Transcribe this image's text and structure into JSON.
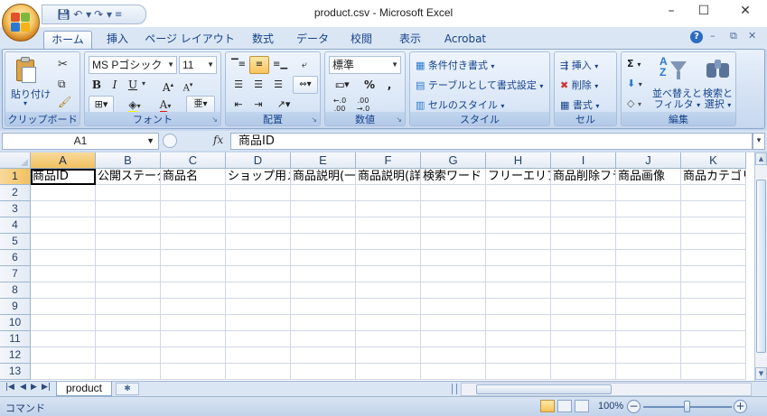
{
  "window": {
    "title": "product.csv - Microsoft Excel",
    "minimize_glyph": "–",
    "maximize_glyph": "☐",
    "close_glyph": "✕"
  },
  "qat": {
    "save_icon": "save-icon",
    "undo_icon": "undo-icon",
    "redo_icon": "redo-icon"
  },
  "ribbon_tabs": [
    "ホーム",
    "挿入",
    "ページ レイアウト",
    "数式",
    "データ",
    "校閲",
    "表示",
    "Acrobat"
  ],
  "active_tab": "ホーム",
  "groups": {
    "clipboard": {
      "label": "クリップボード",
      "paste": "貼り付け"
    },
    "font": {
      "label": "フォント",
      "font_name": "MS Pゴシック",
      "font_size": "11",
      "bold": "B",
      "italic": "I",
      "underline": "U"
    },
    "alignment": {
      "label": "配置"
    },
    "number": {
      "label": "数値",
      "format": "標準",
      "percent": "%",
      "comma": ","
    },
    "styles": {
      "label": "スタイル",
      "conditional": "条件付き書式",
      "table": "テーブルとして書式設定",
      "cell_styles": "セルのスタイル"
    },
    "cells": {
      "label": "セル",
      "insert": "挿入",
      "delete": "削除",
      "format": "書式"
    },
    "editing": {
      "label": "編集",
      "sort_filter_1": "並べ替えと",
      "sort_filter_2": "フィルタ",
      "find_1": "検索と",
      "find_2": "選択"
    }
  },
  "formula_bar": {
    "name_box": "A1",
    "fx": "fx",
    "formula": "商品ID"
  },
  "columns": [
    "A",
    "B",
    "C",
    "D",
    "E",
    "F",
    "G",
    "H",
    "I",
    "J",
    "K"
  ],
  "rows": [
    "1",
    "2",
    "3",
    "4",
    "5",
    "6",
    "7",
    "8",
    "9",
    "10",
    "11",
    "12",
    "13"
  ],
  "row1_cells": [
    "商品ID",
    "公開ステータス",
    "商品名",
    "ショップ用メモ欄",
    "商品説明(一覧)",
    "商品説明(詳細)",
    "検索ワード",
    "フリーエリア",
    "商品削除フラグ",
    "商品画像",
    "商品カテゴリ"
  ],
  "sheet": {
    "name": "product"
  },
  "status": {
    "mode": "コマンド",
    "zoom": "100%",
    "zoom_level_percent": 100
  }
}
